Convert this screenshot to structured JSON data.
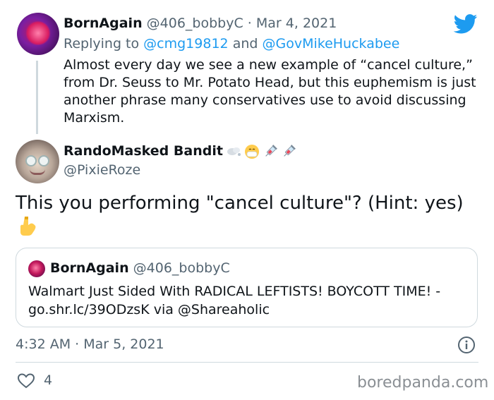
{
  "parent_tweet": {
    "display_name": "BornAgain",
    "handle": "@406_bobbyC",
    "separator": "·",
    "date": "Mar 4, 2021",
    "replying_prefix": "Replying to",
    "reply_mention_1": "@cmg19812",
    "reply_and": "and",
    "reply_mention_2": "@GovMikeHuckabee",
    "text": "Almost every day we see a new example of “cancel culture,” from Dr. Seuss to Mr. Potato Head, but this euphemism is just another phrase many conservatives use to avoid discussing Marxism."
  },
  "main_tweet": {
    "display_name": "RandoMasked Bandit",
    "name_emojis": [
      "dash-icon",
      "mask-face-icon",
      "syringe-icon",
      "syringe-icon"
    ],
    "handle": "@PixieRoze",
    "text": "This you performing \"cancel culture\"? (Hint: yes)",
    "trailing_emoji": "point-down-icon",
    "timestamp": "4:32 AM · Mar 5, 2021",
    "like_count": "4"
  },
  "quoted_tweet": {
    "display_name": "BornAgain",
    "handle": "@406_bobbyC",
    "text": "Walmart Just Sided With RADICAL LEFTISTS! BOYCOTT TIME! - go.shr.lc/39ODzsK via @Shareaholic"
  },
  "watermark": "boredpanda.com",
  "colors": {
    "accent": "#1d9bf0",
    "secondary_text": "#536471",
    "border": "#cfd9de"
  }
}
